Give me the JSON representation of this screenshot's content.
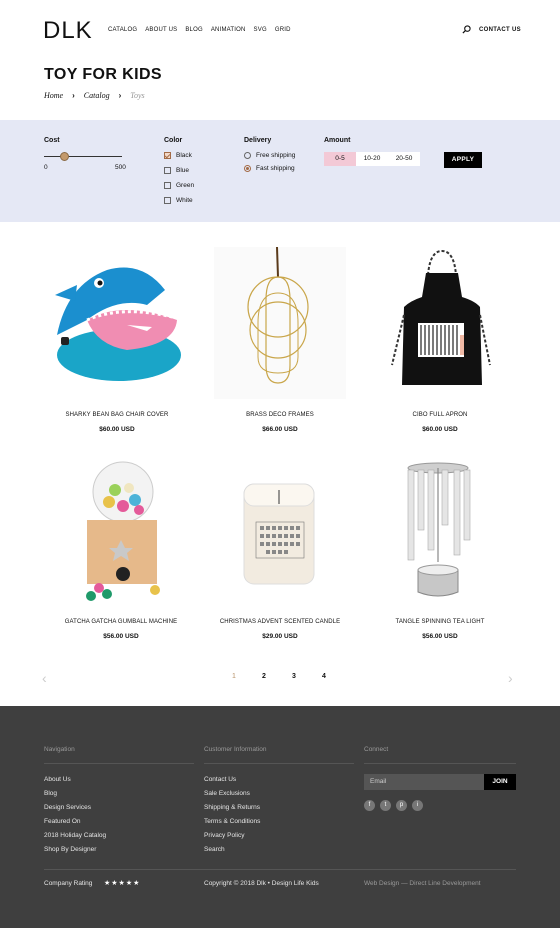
{
  "header": {
    "logo": "DLK",
    "nav": [
      "CATALOG",
      "ABOUT US",
      "BLOG",
      "ANIMATION",
      "SVG",
      "GRID"
    ],
    "contact": "CONTACT US",
    "search_icon": "search-icon"
  },
  "page": {
    "title": "TOY FOR KIDS",
    "breadcrumb": [
      "Home",
      "Catalog",
      "Toys"
    ]
  },
  "filters": {
    "cost": {
      "title": "Cost",
      "min": "0",
      "max": "500"
    },
    "color": {
      "title": "Color",
      "options": [
        {
          "label": "Black",
          "checked": true
        },
        {
          "label": "Blue",
          "checked": false
        },
        {
          "label": "Green",
          "checked": false
        },
        {
          "label": "White",
          "checked": false
        }
      ]
    },
    "delivery": {
      "title": "Delivery",
      "options": [
        {
          "label": "Free shipping",
          "selected": false
        },
        {
          "label": "Fast shipping",
          "selected": true
        }
      ]
    },
    "amount": {
      "title": "Amount",
      "options": [
        "0-5",
        "10-20",
        "20-50"
      ],
      "selected": "0-5"
    },
    "apply": "APPLY",
    "accent_color": "#f3c9d6",
    "panel_color": "#e5e8f5"
  },
  "products": [
    {
      "name": "SHARKY BEAN BAG CHAIR COVER",
      "price": "$60.00 USD"
    },
    {
      "name": "BRASS DECO FRAMES",
      "price": "$66.00 USD"
    },
    {
      "name": "CIBO FULL APRON",
      "price": "$60.00 USD"
    },
    {
      "name": "GATCHA GATCHA GUMBALL MACHINE",
      "price": "$56.00 USD"
    },
    {
      "name": "CHRISTMAS ADVENT SCENTED CANDLE",
      "price": "$29.00 USD"
    },
    {
      "name": "TANGLE SPINNING TEA LIGHT",
      "price": "$56.00 USD"
    }
  ],
  "pagination": {
    "pages": [
      "1",
      "2",
      "3",
      "4"
    ],
    "current": "1",
    "prev": "‹",
    "next": "›"
  },
  "footer": {
    "navigation": {
      "title": "Navigation",
      "items": [
        "About Us",
        "Blog",
        "Design Services",
        "Featured On",
        "2018 Holiday Catalog",
        "Shop By Designer"
      ]
    },
    "customer": {
      "title": "Customer Information",
      "items": [
        "Contact Us",
        "Sale Exclusions",
        "Shipping & Returns",
        "Terms & Conditions",
        "Privacy Policy",
        "Search"
      ]
    },
    "connect": {
      "title": "Connect",
      "email_placeholder": "Email",
      "join": "JOIN",
      "socials": [
        "f",
        "t",
        "p",
        "i"
      ]
    },
    "rating_label": "Company Rating",
    "stars": "★★★★★",
    "copyright": "Copyright © 2018 Dlk • Design Life Kids",
    "credit": "Web Design — Direct Line Development",
    "background": "#3f3f3f"
  }
}
